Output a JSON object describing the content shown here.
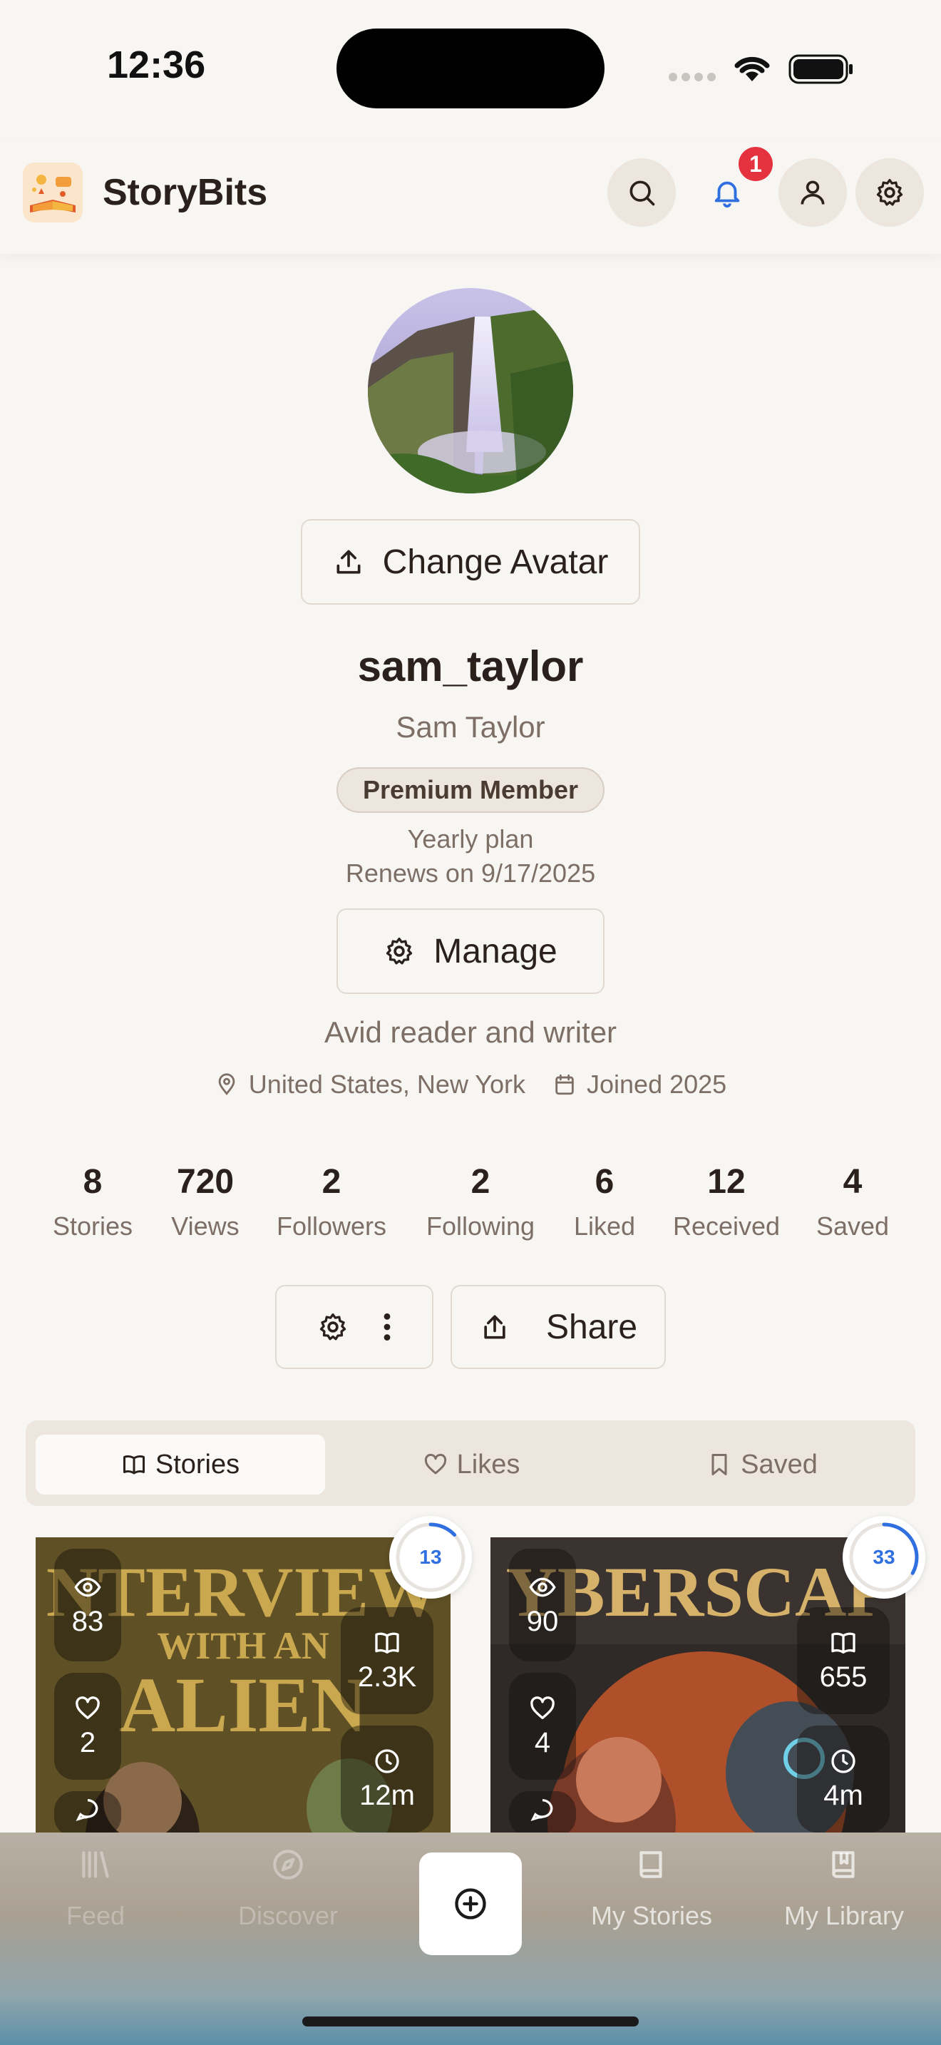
{
  "status_bar": {
    "time": "12:36"
  },
  "header": {
    "app_name": "StoryBits",
    "notification_count": "1"
  },
  "profile": {
    "change_avatar_label": "Change Avatar",
    "username": "sam_taylor",
    "full_name": "Sam Taylor",
    "membership_badge": "Premium Member",
    "plan": "Yearly plan",
    "renewal": "Renews on 9/17/2025",
    "manage_label": "Manage",
    "bio": "Avid reader and writer",
    "location": "United States, New York",
    "joined": "Joined 2025"
  },
  "stats": [
    {
      "value": "8",
      "label": "Stories"
    },
    {
      "value": "720",
      "label": "Views"
    },
    {
      "value": "2",
      "label": "Followers"
    },
    {
      "value": "2",
      "label": "Following"
    },
    {
      "value": "6",
      "label": "Liked"
    },
    {
      "value": "12",
      "label": "Received"
    },
    {
      "value": "4",
      "label": "Saved"
    }
  ],
  "actions": {
    "share_label": "Share"
  },
  "tabs": [
    {
      "label": "Stories",
      "active": true
    },
    {
      "label": "Likes",
      "active": false
    },
    {
      "label": "Saved",
      "active": false
    }
  ],
  "stories": [
    {
      "title_art": "INTERVIEW WITH AN ALIEN",
      "views": "83",
      "likes": "2",
      "reads": "2.3K",
      "duration": "12m",
      "progress_label": "13",
      "progress_fraction": 0.13,
      "cover_color": "#6b5a2a"
    },
    {
      "title_art": "CYBERSCAPE",
      "views": "90",
      "likes": "4",
      "reads": "655",
      "duration": "4m",
      "progress_label": "33",
      "progress_fraction": 0.33,
      "cover_color": "#3a3330"
    }
  ],
  "bottom_nav": [
    {
      "label": "Feed",
      "icon": "library-icon"
    },
    {
      "label": "Discover",
      "icon": "compass-icon"
    },
    {
      "label": "",
      "icon": "plus-circle-icon"
    },
    {
      "label": "My Stories",
      "icon": "book-icon"
    },
    {
      "label": "My Library",
      "icon": "bookmark-book-icon"
    }
  ],
  "colors": {
    "accent_blue": "#2f6fe0",
    "badge_red": "#e5323f",
    "text_dark": "#2b211c",
    "text_muted": "#7d6f66"
  }
}
